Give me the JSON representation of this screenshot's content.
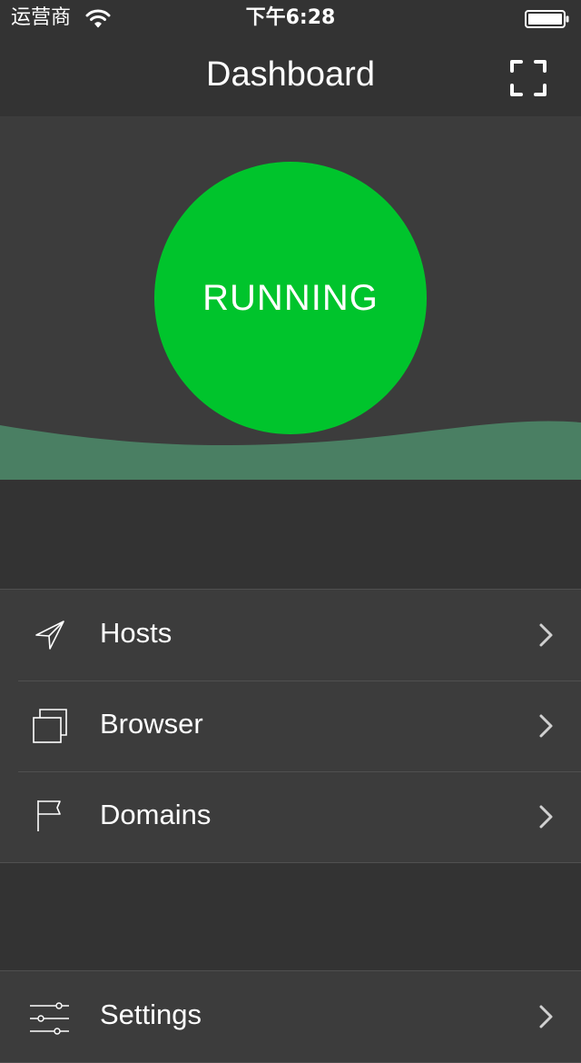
{
  "status_bar": {
    "carrier": "运营商",
    "time": "下午6:28",
    "wifi_icon": "wifi-icon",
    "battery_icon": "battery-icon"
  },
  "nav": {
    "title": "Dashboard",
    "right_icon": "fullscreen-icon"
  },
  "status": {
    "label": "RUNNING",
    "color": "#00c42c"
  },
  "colors": {
    "background": "#333333",
    "panel": "#3c3c3c",
    "wave": "#4a7f63",
    "divider": "#505050",
    "text": "#ffffff"
  },
  "menu": {
    "items": [
      {
        "label": "Hosts",
        "icon": "paper-plane-icon"
      },
      {
        "label": "Browser",
        "icon": "windows-icon"
      },
      {
        "label": "Domains",
        "icon": "flag-icon"
      }
    ]
  },
  "settings": {
    "label": "Settings",
    "icon": "sliders-icon"
  }
}
